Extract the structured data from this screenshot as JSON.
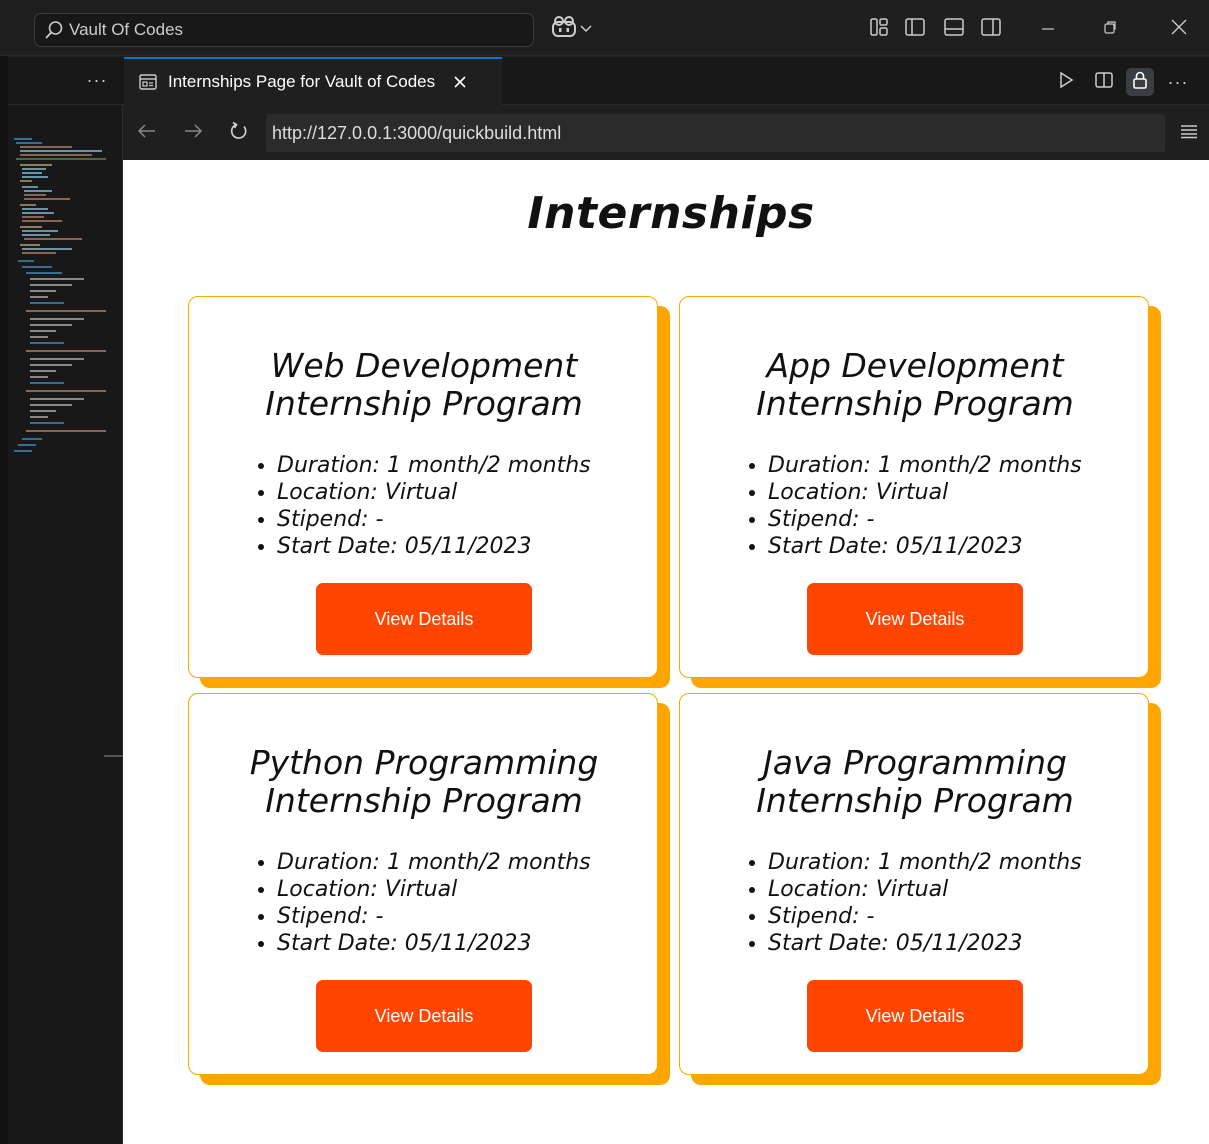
{
  "window": {
    "search_text": "Vault Of Codes"
  },
  "editor": {
    "tab_title": "Internships Page for Vault of Codes",
    "sidebar_ellipsis": "···",
    "actions_ellipsis": "···"
  },
  "browser": {
    "url": "http://127.0.0.1:3000/quickbuild.html"
  },
  "page": {
    "heading": "Internships",
    "cards": [
      {
        "title_line1": "Web Development",
        "title_line2": "Internship Program",
        "details": [
          "Duration: 1 month/2 months",
          "Location: Virtual",
          "Stipend: -",
          "Start Date: 05/11/2023"
        ],
        "button": "View Details"
      },
      {
        "title_line1": "App Development",
        "title_line2": "Internship Program",
        "details": [
          "Duration: 1 month/2 months",
          "Location: Virtual",
          "Stipend: -",
          "Start Date: 05/11/2023"
        ],
        "button": "View Details"
      },
      {
        "title_line1": "Python Programming",
        "title_line2": "Internship Program",
        "details": [
          "Duration: 1 month/2 months",
          "Location: Virtual",
          "Stipend: -",
          "Start Date: 05/11/2023"
        ],
        "button": "View Details"
      },
      {
        "title_line1": "Java Programming",
        "title_line2": "Internship Program",
        "details": [
          "Duration: 1 month/2 months",
          "Location: Virtual",
          "Stipend: -",
          "Start Date: 05/11/2023"
        ],
        "button": "View Details"
      }
    ]
  },
  "colors": {
    "accent": "#ffa500",
    "button": "#ff4500",
    "tab_active_border": "#0078d4",
    "chrome_bg": "#1f1f1f"
  }
}
